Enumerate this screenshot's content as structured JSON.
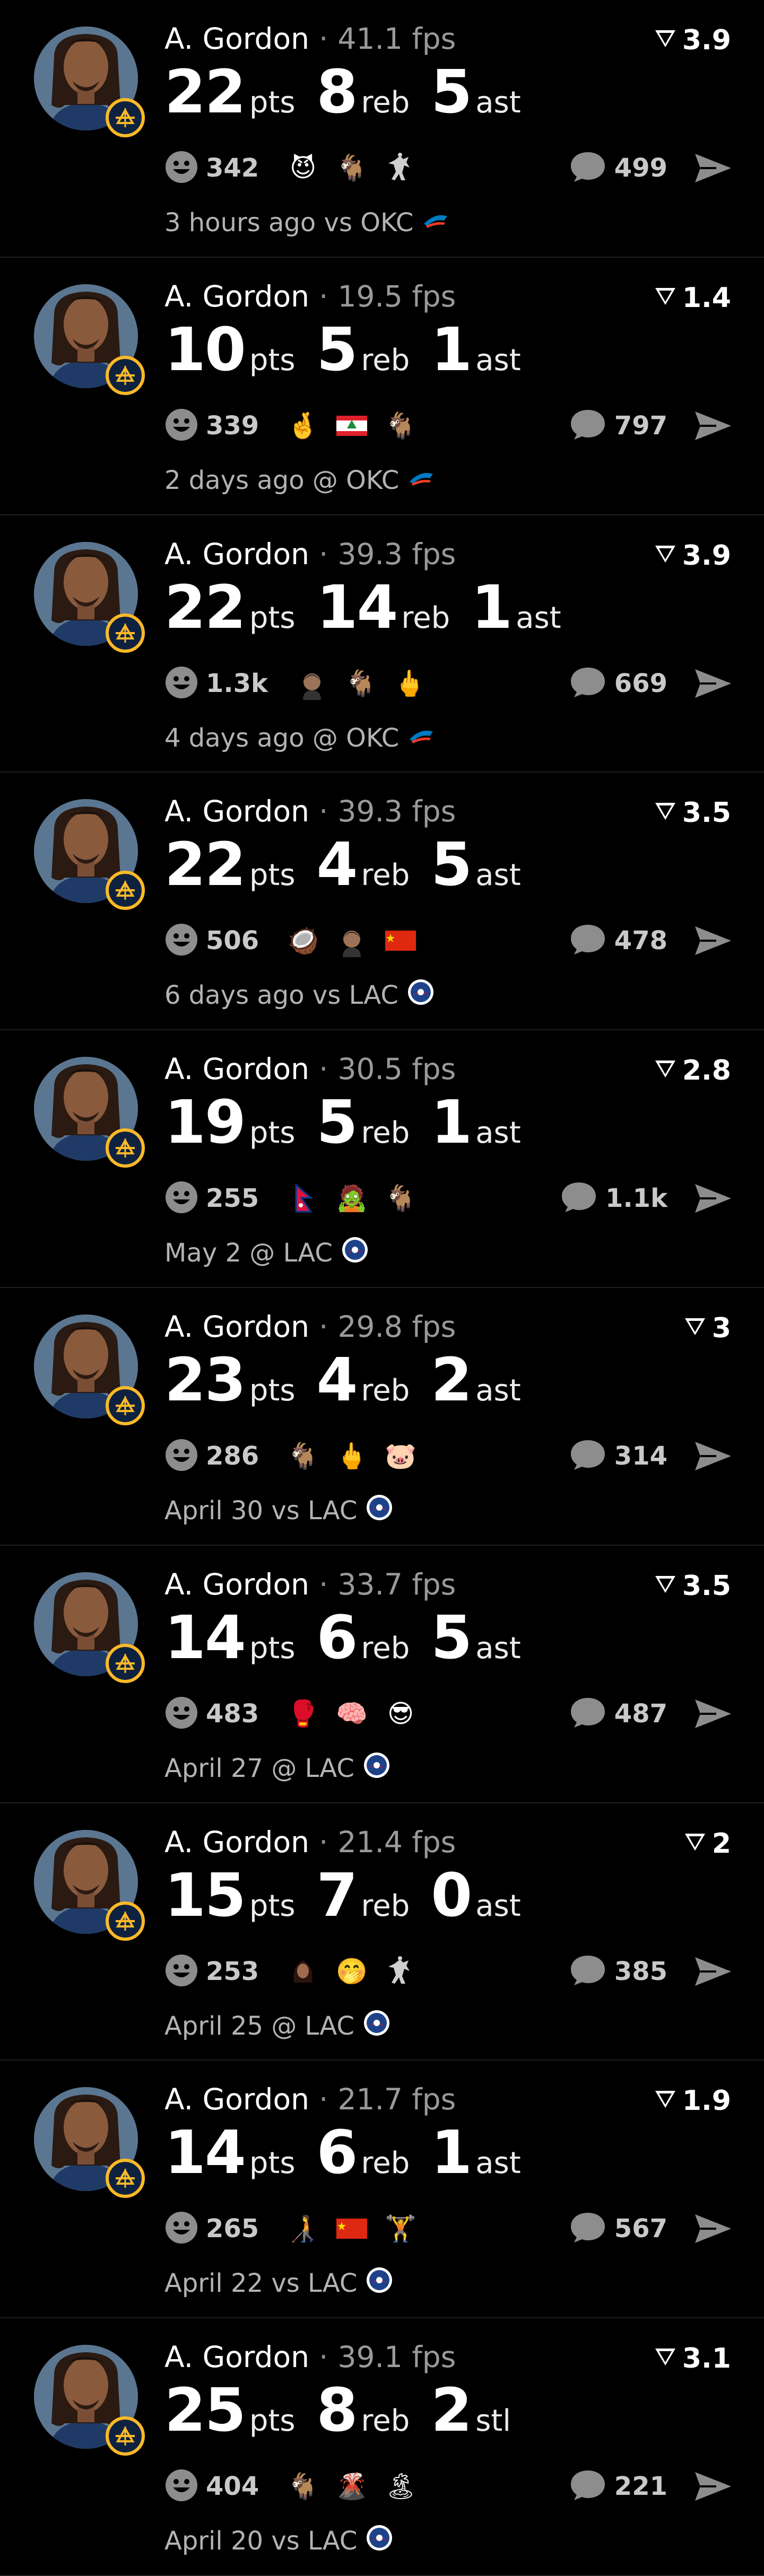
{
  "player": {
    "name": "A. Gordon",
    "separator": "·"
  },
  "colors": {
    "background": "#000000",
    "divider": "#1e1e1e",
    "text_primary": "#ffffff",
    "text_secondary": "#9a9a9a",
    "nuggets_gold": "#fdb927",
    "nuggets_navy": "#0e2240",
    "okc_blue": "#007ac1",
    "lac_blue": "#1d428a"
  },
  "cards": [
    {
      "fps": "41.1 fps",
      "rating": "3.9",
      "stats": [
        {
          "value": "22",
          "label": "pts"
        },
        {
          "value": "8",
          "label": "reb"
        },
        {
          "value": "5",
          "label": "ast"
        }
      ],
      "reactions_count": "342",
      "reaction_emojis": [
        "smiling-devil",
        "goat",
        "dunk-silhouette"
      ],
      "comments_count": "499",
      "game_when": "3 hours ago",
      "game_venue": "vs",
      "opponent": "OKC",
      "opponent_logo": "okc-thunder-logo"
    },
    {
      "fps": "19.5 fps",
      "rating": "1.4",
      "stats": [
        {
          "value": "10",
          "label": "pts"
        },
        {
          "value": "5",
          "label": "reb"
        },
        {
          "value": "1",
          "label": "ast"
        }
      ],
      "reactions_count": "339",
      "reaction_emojis": [
        "crossed-fingers",
        "lebanon-flag",
        "goat"
      ],
      "comments_count": "797",
      "game_when": "2 days ago",
      "game_venue": "@",
      "opponent": "OKC",
      "opponent_logo": "okc-thunder-logo"
    },
    {
      "fps": "39.3 fps",
      "rating": "3.9",
      "stats": [
        {
          "value": "22",
          "label": "pts"
        },
        {
          "value": "14",
          "label": "reb"
        },
        {
          "value": "1",
          "label": "ast"
        }
      ],
      "reactions_count": "1.3k",
      "reaction_emojis": [
        "person-face",
        "goat",
        "middle-finger"
      ],
      "comments_count": "669",
      "game_when": "4 days ago",
      "game_venue": "@",
      "opponent": "OKC",
      "opponent_logo": "okc-thunder-logo"
    },
    {
      "fps": "39.3 fps",
      "rating": "3.5",
      "stats": [
        {
          "value": "22",
          "label": "pts"
        },
        {
          "value": "4",
          "label": "reb"
        },
        {
          "value": "5",
          "label": "ast"
        }
      ],
      "reactions_count": "506",
      "reaction_emojis": [
        "coconut",
        "person-face",
        "china-flag"
      ],
      "comments_count": "478",
      "game_when": "6 days ago",
      "game_venue": "vs",
      "opponent": "LAC",
      "opponent_logo": "la-clippers-logo"
    },
    {
      "fps": "30.5 fps",
      "rating": "2.8",
      "stats": [
        {
          "value": "19",
          "label": "pts"
        },
        {
          "value": "5",
          "label": "reb"
        },
        {
          "value": "1",
          "label": "ast"
        }
      ],
      "reactions_count": "255",
      "reaction_emojis": [
        "nepal-flag",
        "zombie",
        "goat"
      ],
      "comments_count": "1.1k",
      "game_when": "May 2",
      "game_venue": "@",
      "opponent": "LAC",
      "opponent_logo": "la-clippers-logo"
    },
    {
      "fps": "29.8 fps",
      "rating": "3",
      "stats": [
        {
          "value": "23",
          "label": "pts"
        },
        {
          "value": "4",
          "label": "reb"
        },
        {
          "value": "2",
          "label": "ast"
        }
      ],
      "reactions_count": "286",
      "reaction_emojis": [
        "goat",
        "middle-finger",
        "pig-face"
      ],
      "comments_count": "314",
      "game_when": "April 30",
      "game_venue": "vs",
      "opponent": "LAC",
      "opponent_logo": "la-clippers-logo"
    },
    {
      "fps": "33.7 fps",
      "rating": "3.5",
      "stats": [
        {
          "value": "14",
          "label": "pts"
        },
        {
          "value": "6",
          "label": "reb"
        },
        {
          "value": "5",
          "label": "ast"
        }
      ],
      "reactions_count": "483",
      "reaction_emojis": [
        "boxing-glove",
        "brain",
        "sunglasses-face"
      ],
      "comments_count": "487",
      "game_when": "April 27",
      "game_venue": "@",
      "opponent": "LAC",
      "opponent_logo": "la-clippers-logo"
    },
    {
      "fps": "21.4 fps",
      "rating": "2",
      "stats": [
        {
          "value": "15",
          "label": "pts"
        },
        {
          "value": "7",
          "label": "reb"
        },
        {
          "value": "0",
          "label": "ast"
        }
      ],
      "reactions_count": "253",
      "reaction_emojis": [
        "woman-face",
        "face-hand-over-mouth",
        "dunk-silhouette"
      ],
      "comments_count": "385",
      "game_when": "April 25",
      "game_venue": "@",
      "opponent": "LAC",
      "opponent_logo": "la-clippers-logo"
    },
    {
      "fps": "21.7 fps",
      "rating": "1.9",
      "stats": [
        {
          "value": "14",
          "label": "pts"
        },
        {
          "value": "6",
          "label": "reb"
        },
        {
          "value": "1",
          "label": "ast"
        }
      ],
      "reactions_count": "265",
      "reaction_emojis": [
        "person-walking-cane",
        "china-flag",
        "person-lifting"
      ],
      "comments_count": "567",
      "game_when": "April 22",
      "game_venue": "vs",
      "opponent": "LAC",
      "opponent_logo": "la-clippers-logo"
    },
    {
      "fps": "39.1 fps",
      "rating": "3.1",
      "stats": [
        {
          "value": "25",
          "label": "pts"
        },
        {
          "value": "8",
          "label": "reb"
        },
        {
          "value": "2",
          "label": "stl"
        }
      ],
      "reactions_count": "404",
      "reaction_emojis": [
        "goat",
        "volcano",
        "desert-island"
      ],
      "comments_count": "221",
      "game_when": "April 20",
      "game_venue": "vs",
      "opponent": "LAC",
      "opponent_logo": "la-clippers-logo"
    }
  ]
}
